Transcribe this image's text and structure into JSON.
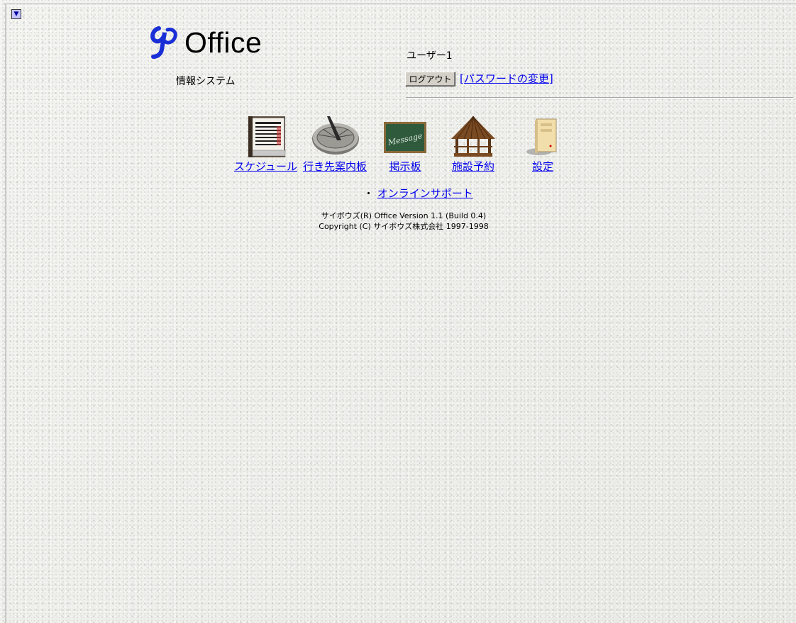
{
  "header": {
    "logo_text": "Office",
    "subtitle": "情報システム",
    "username": "ユーザー1",
    "logout_label": "ログアウト",
    "password_link": "[パスワードの変更]"
  },
  "apps": [
    {
      "label": "スケジュール",
      "icon": "calendar-icon"
    },
    {
      "label": "行き先案内板",
      "icon": "sundial-icon"
    },
    {
      "label": "掲示板",
      "icon": "message-board-icon"
    },
    {
      "label": "施設予約",
      "icon": "gazebo-icon"
    },
    {
      "label": "設定",
      "icon": "computer-icon"
    }
  ],
  "support": {
    "bullet": "・",
    "link_label": "オンラインサポート"
  },
  "footer": {
    "version": "サイボウズ(R) Office Version 1.1 (Build 0.4)",
    "copyright": "Copyright (C) サイボウズ株式会社 1997-1998"
  },
  "colors": {
    "link": "#0000ee",
    "logo_blue": "#1a2fd6"
  }
}
